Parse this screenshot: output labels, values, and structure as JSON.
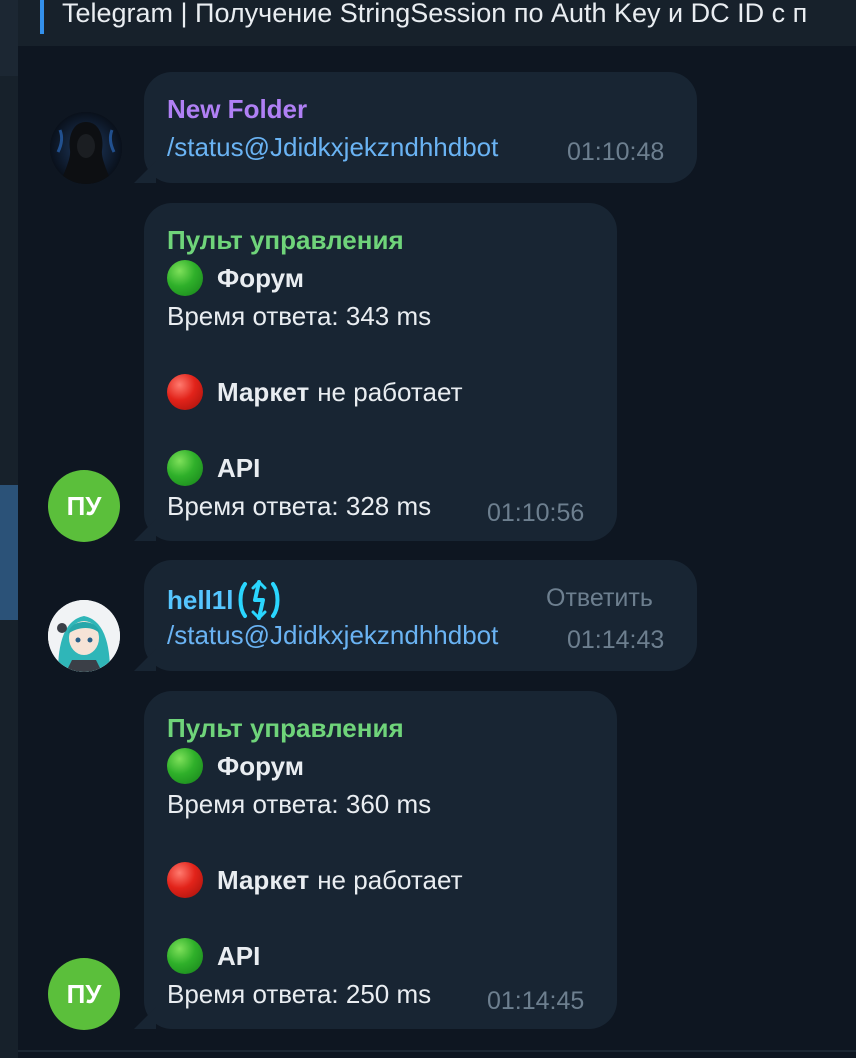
{
  "window": {
    "title": "Telegram | Получение StringSession по Auth Key и DC ID с п"
  },
  "messages": [
    {
      "sender": "New Folder",
      "sender_color": "#b080f5",
      "text": "/status@Jdidkxjekzndhhdbot",
      "time": "01:10:48",
      "avatar_icon": "hooded-figure-avatar"
    },
    {
      "sender": "Пульт управления",
      "sender_color": "#6fd47a",
      "avatar_initials": "ПУ",
      "status": {
        "forum_label": "Форум",
        "forum_status": "green",
        "forum_time": "Время ответа: 343 ms",
        "market_label": "Маркет",
        "market_suffix": "не работает",
        "market_status": "red",
        "api_label": "API",
        "api_status": "green",
        "api_time": "Время ответа: 328 ms"
      },
      "time": "01:10:56"
    },
    {
      "sender": "hell1l",
      "sender_color": "#56c6ff",
      "text": "/status@Jdidkxjekzndhhdbot",
      "time": "01:14:43",
      "reply_label": "Ответить",
      "avatar_icon": "anime-character-avatar",
      "badge_icon": "custom-emoji-badge-icon"
    },
    {
      "sender": "Пульт управления",
      "sender_color": "#6fd47a",
      "avatar_initials": "ПУ",
      "status": {
        "forum_label": "Форум",
        "forum_status": "green",
        "forum_time": "Время ответа: 360 ms",
        "market_label": "Маркет",
        "market_suffix": "не работает",
        "market_status": "red",
        "api_label": "API",
        "api_status": "green",
        "api_time": "Время ответа: 250 ms"
      },
      "time": "01:14:45"
    }
  ]
}
